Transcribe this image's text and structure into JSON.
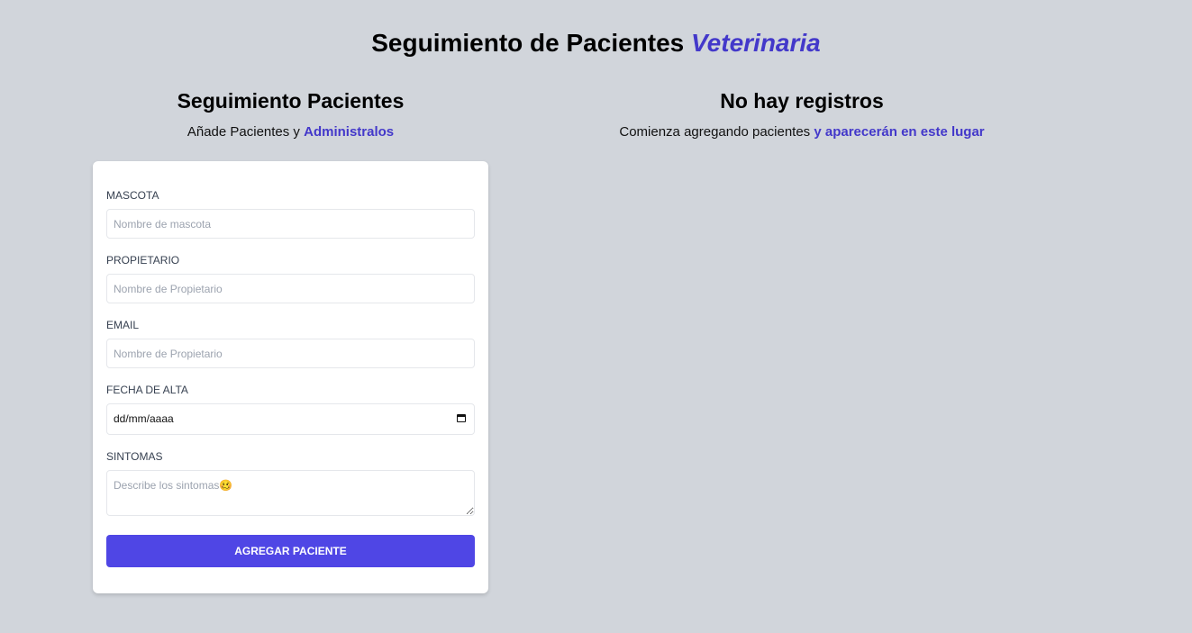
{
  "header": {
    "title_main": "Seguimiento de Pacientes",
    "title_accent": "Veterinaria"
  },
  "form_section": {
    "title": "Seguimiento Pacientes",
    "subtitle_text": "Añade Pacientes y",
    "subtitle_accent": "Administralos"
  },
  "list_section": {
    "title": "No hay registros",
    "subtitle_text": "Comienza agregando pacientes",
    "subtitle_accent": "y aparecerán en este lugar"
  },
  "form": {
    "mascota_label": "MASCOTA",
    "mascota_placeholder": "Nombre de mascota",
    "propietario_label": "PROPIETARIO",
    "propietario_placeholder": "Nombre de Propietario",
    "email_label": "EMAIL",
    "email_placeholder": "Nombre de Propietario",
    "fecha_label": "FECHA DE ALTA",
    "fecha_value": "dd/mm/aaaa",
    "sintomas_label": "SINTOMAS",
    "sintomas_placeholder": "Describe los sintomas🥴",
    "submit_label": "AGREGAR PACIENTE"
  },
  "colors": {
    "background": "#d1d5db",
    "accent": "#4338ca",
    "button": "#4f46e5"
  },
  "icons": {
    "date_picker": "calendar-icon"
  }
}
